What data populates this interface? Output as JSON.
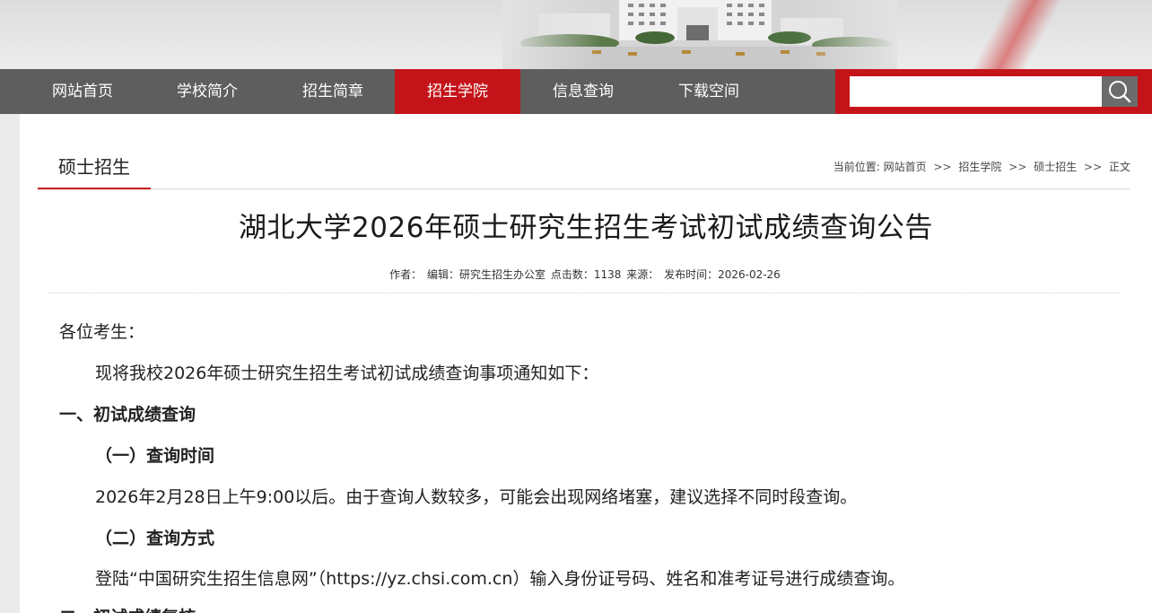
{
  "nav": {
    "items": [
      {
        "label": "网站首页"
      },
      {
        "label": "学校简介"
      },
      {
        "label": "招生简章"
      },
      {
        "label": "招生学院",
        "active": true
      },
      {
        "label": "信息查询"
      },
      {
        "label": "下载空间"
      }
    ],
    "search": {
      "value": "",
      "placeholder": ""
    }
  },
  "section": {
    "title": "硕士招生"
  },
  "breadcrumb": {
    "prefix": "当前位置:",
    "items": [
      "网站首页",
      "招生学院",
      "硕士招生",
      "正文"
    ],
    "separator": ">>"
  },
  "article": {
    "title": "湖北大学2026年硕士研究生招生考试初试成绩查询公告",
    "meta": {
      "author": "作者：",
      "editor": "编辑：研究生招生办公室",
      "clicks": "点击数：1138",
      "source": "来源：",
      "date": "发布时间：2026-02-26"
    },
    "greeting": "各位考生：",
    "intro": "现将我校2026年硕士研究生招生考试初试成绩查询事项通知如下：",
    "h1": "一、初试成绩查询",
    "h1_1": "（一）查询时间",
    "p1": "2026年2月28日上午9:00以后。由于查询人数较多，可能会出现网络堵塞，建议选择不同时段查询。",
    "h1_2": "（二）查询方式",
    "p2": "登陆“中国研究生招生信息网”（https://yz.chsi.com.cn）输入身份证号码、姓名和准考证号进行成绩查询。",
    "h2": "二、初试成绩复核"
  },
  "colors": {
    "nav_bg": "#5e5e5e",
    "accent_red": "#c4141a",
    "search_btn": "#6b6b6b"
  },
  "icons": {
    "search": "search-icon"
  }
}
